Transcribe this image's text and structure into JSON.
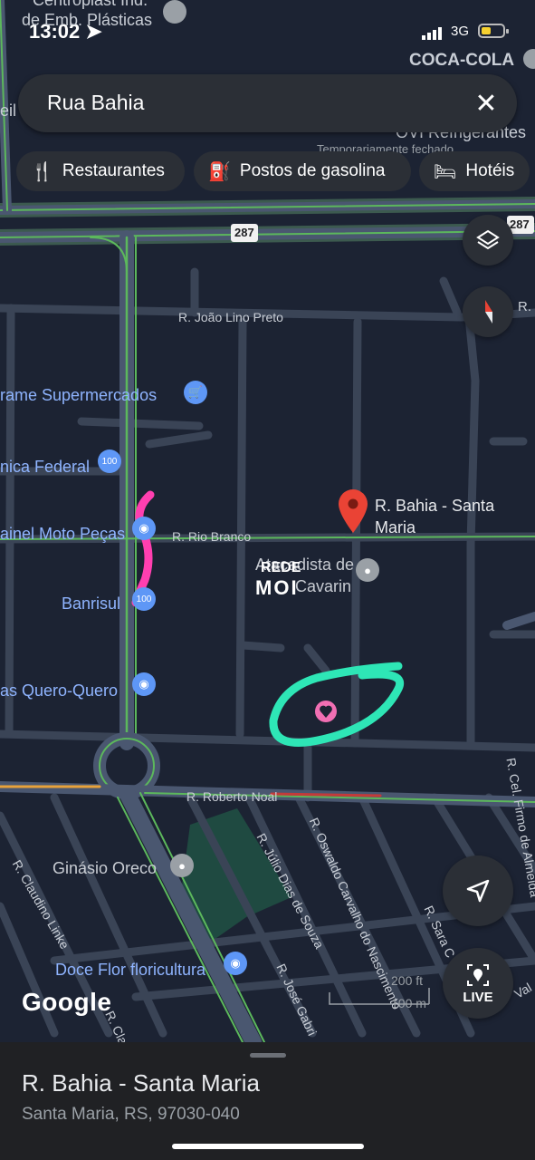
{
  "status_bar": {
    "time": "13:02",
    "network": "3G"
  },
  "search": {
    "query": "Rua Bahia"
  },
  "chips": [
    {
      "label": "Restaurantes",
      "icon": "fork-knife-icon"
    },
    {
      "label": "Postos de gasolina",
      "icon": "gas-station-icon"
    },
    {
      "label": "Hotéis",
      "icon": "bed-icon"
    }
  ],
  "map": {
    "top_labels": {
      "centroplast": "Centroplast Ind.",
      "emb": "de Emb. Plásticas",
      "coca_cola": "COCA-COLA",
      "ovi": "OVI Refrigerantes",
      "ovi_sub": "Temporariamente fechado",
      "eil": "eil"
    },
    "highway_shield": "287",
    "highway_shield_right": "287",
    "streets": {
      "joao_lino": "R. João Lino Preto",
      "rio_branco": "R. Rio Branco",
      "roberto_noal": "R. Roberto Noal",
      "claudino": "R. Claudino Linke",
      "julio": "R. Júlio Dias de Souza",
      "oswaldo": "R. Oswaldo Carvalho do Nascimento",
      "sara": "R. Sara C",
      "jose": "R. José Gabri",
      "clar": "R. Clar",
      "firmo": "R. Cel. Firmo de Almeida",
      "val": "Val",
      "r_right": "R."
    },
    "pois": {
      "supermercado": "rame Supermercados",
      "caixa": "nica Federal",
      "moto": "ainel Moto Peças",
      "banrisul": "Banrisul",
      "quero": "as Quero-Quero",
      "atacadista_1": "Atacadista de",
      "atacadista_2": "Cavarin",
      "ginasio": "Ginásio Oreco",
      "doce_flor": "Doce Flor floricultura"
    },
    "selected_pin": {
      "line1": "R. Bahia - Santa",
      "line2": "Maria"
    },
    "watermark": {
      "line1": "REDE",
      "line2": "MOI"
    },
    "logo": "Google",
    "scale": {
      "ft": "200 ft",
      "m": "100 m"
    }
  },
  "buttons": {
    "layers": "layers-icon",
    "compass": "compass-icon",
    "my_location": "navigate-arrow-icon",
    "live": "LIVE"
  },
  "place": {
    "title": "R. Bahia - Santa Maria",
    "address": "Santa Maria, RS, 97030-040"
  }
}
